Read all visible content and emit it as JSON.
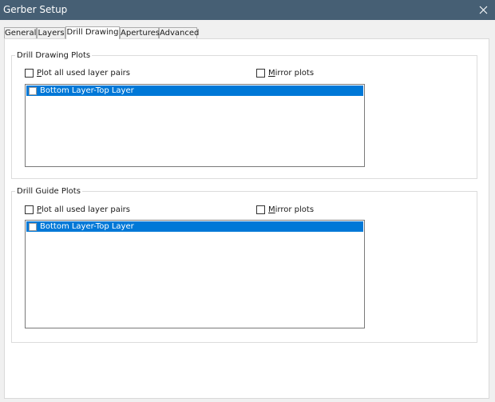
{
  "window": {
    "title": "Gerber Setup",
    "close_icon": "close-icon"
  },
  "tabs": [
    {
      "label": "General",
      "active": false
    },
    {
      "label": "Layers",
      "active": false
    },
    {
      "label": "Drill Drawing",
      "active": true
    },
    {
      "label": "Apertures",
      "active": false
    },
    {
      "label": "Advanced",
      "active": false
    }
  ],
  "drill_drawing": {
    "group_title": "Drill Drawing Plots",
    "plot_all_label": "Plot all used layer pairs",
    "plot_all_checked": false,
    "mirror_label": "Mirror plots",
    "mirror_checked": false,
    "layer_pairs": [
      {
        "label": "Bottom Layer-Top Layer",
        "checked": false,
        "selected": true
      }
    ]
  },
  "drill_guide": {
    "group_title": "Drill Guide Plots",
    "plot_all_label": "Plot all used layer pairs",
    "plot_all_checked": false,
    "mirror_label": "Mirror plots",
    "mirror_checked": false,
    "layer_pairs": [
      {
        "label": "Bottom Layer-Top Layer",
        "checked": false,
        "selected": true
      }
    ]
  },
  "colors": {
    "titlebar": "#465f74",
    "selection": "#0078d7"
  }
}
